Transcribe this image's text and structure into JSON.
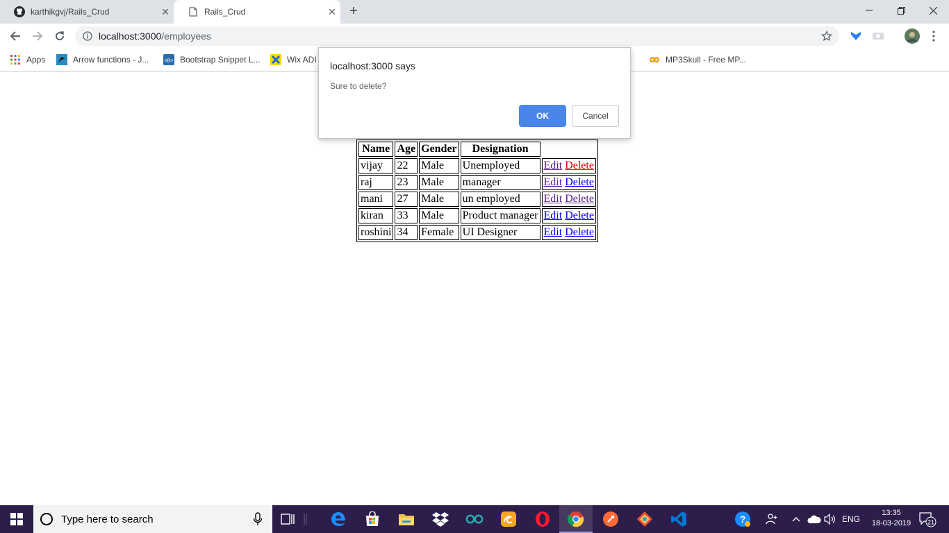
{
  "browser": {
    "tabs": [
      {
        "title": "karthikgvj/Rails_Crud",
        "favicon": "github-icon"
      },
      {
        "title": "Rails_Crud",
        "favicon": "page-icon",
        "active": true
      }
    ],
    "url_host": "localhost:3000",
    "url_path": "/employees",
    "bookmarks": [
      {
        "label": "Apps",
        "icon": "apps-grid-icon"
      },
      {
        "label": "Arrow functions - J...",
        "icon": "bookmark-favicon"
      },
      {
        "label": "Bootstrap Snippet L...",
        "icon": "bootstrap-icon"
      },
      {
        "label": "Wix ADI",
        "icon": "wix-icon"
      },
      {
        "label": ".",
        "icon": ""
      },
      {
        "label": "MP3Skull - Free MP...",
        "icon": "mp3skull-icon"
      }
    ]
  },
  "dialog": {
    "title": "localhost:3000 says",
    "message": "Sure to delete?",
    "ok_label": "OK",
    "cancel_label": "Cancel"
  },
  "table": {
    "headers": [
      "Name",
      "Age",
      "Gender",
      "Designation"
    ],
    "edit_label": "Edit",
    "delete_label": "Delete",
    "rows": [
      {
        "name": "vijay",
        "age": "22",
        "gender": "Male",
        "designation": "Unemployed"
      },
      {
        "name": "raj",
        "age": "23",
        "gender": "Male",
        "designation": "manager"
      },
      {
        "name": "mani",
        "age": "27",
        "gender": "Male",
        "designation": "un employed"
      },
      {
        "name": "kiran",
        "age": "33",
        "gender": "Male",
        "designation": "Product manager"
      },
      {
        "name": "roshini",
        "age": "34",
        "gender": "Female",
        "designation": "UI Designer"
      }
    ]
  },
  "taskbar": {
    "search_placeholder": "Type here to search",
    "language": "ENG",
    "time": "13:35",
    "date": "18-03-2019",
    "notification_count": "21"
  },
  "colors": {
    "taskbar": "#2c1d4a",
    "dialog_ok": "#4a86e8",
    "link": "#0000ee",
    "visited_link": "#551a8b",
    "active_link": "#e00000"
  }
}
